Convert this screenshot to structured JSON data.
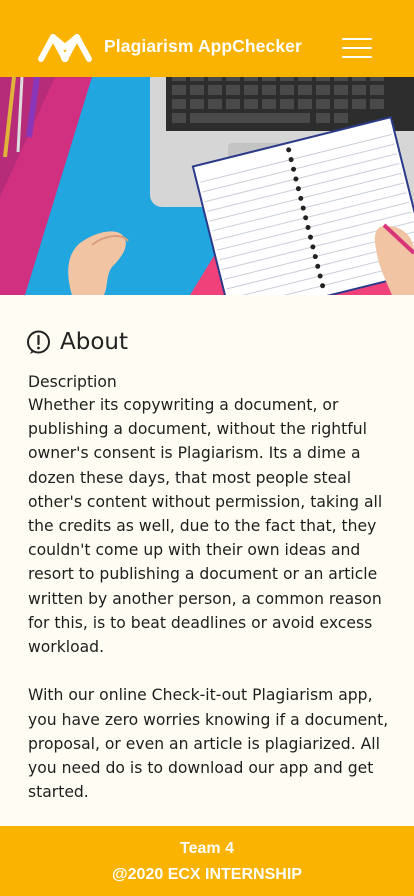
{
  "header": {
    "title": "Plagiarism AppChecker",
    "logo_icon": "mountains-logo-icon",
    "menu_icon": "hamburger-menu-icon",
    "background": "#f9b300"
  },
  "hero": {
    "icon": "laptop-notebook-desk-photo"
  },
  "about": {
    "icon": "info-circle-icon",
    "title": "About",
    "description_label": "Description",
    "paragraphs": [
      "Whether  its copywriting a document, or publishing  a document, without  the rightful owner's  consent is Plagiarism. Its a dime a dozen these days, that most people steal other's content without permission, taking  all the credits as well, due to the fact that, they couldn't  come up with their own ideas and resort to publishing  a document  or an article written by another person, a common reason for this, is to beat deadlines or avoid excess workload.",
      "With our online  Check-it-out  Plagiarism app, you have zero worries knowing if a document, proposal, or even an article  is plagiarized.  All you need do is to download our app and get started."
    ]
  },
  "footer": {
    "team": "Team 4",
    "copyright": "@2020 ECX INTERNSHIP",
    "background": "#f9b300"
  }
}
